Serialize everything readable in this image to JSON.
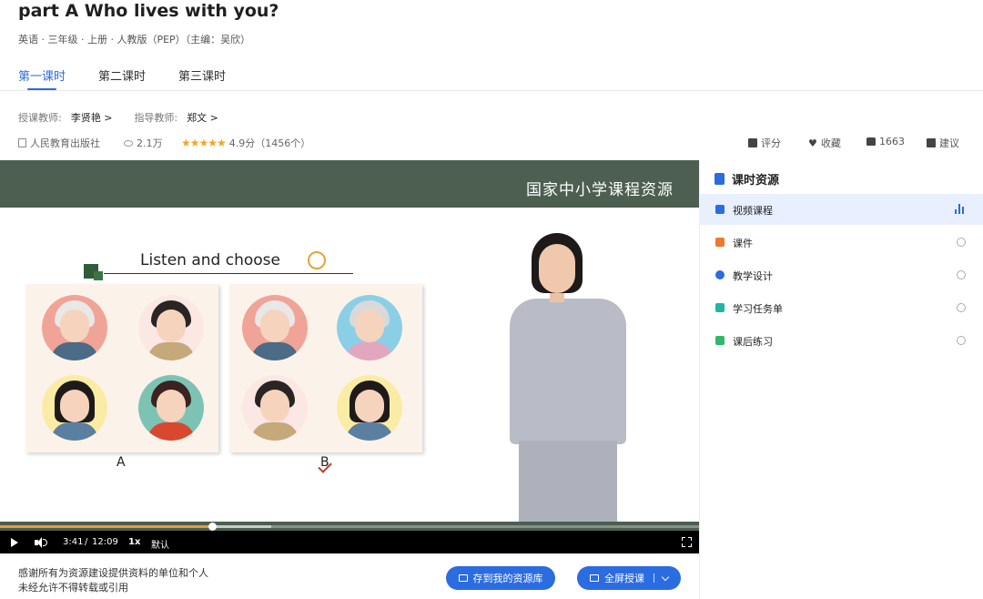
{
  "header": {
    "title": "part A Who lives with you?",
    "meta": "英语 · 三年级 · 上册 · 人教版（PEP）（主编：吴欣）"
  },
  "tabs": [
    {
      "label": "第一课时",
      "active": true
    },
    {
      "label": "第二课时",
      "active": false
    },
    {
      "label": "第三课时",
      "active": false
    }
  ],
  "teachers": {
    "lecturer_label": "授课教师:",
    "lecturer_name": "李贤艳",
    "advisor_label": "指导教师:",
    "advisor_name": "郑文",
    "chevron": ">"
  },
  "info": {
    "publisher": "人民教育出版社",
    "views": "2.1万",
    "stars": "★★★★★",
    "rating": "4.9分（1456个）",
    "actions": {
      "rate": "评分",
      "favorite": "收藏",
      "likes": "1663",
      "suggest": "建议"
    }
  },
  "video": {
    "banner": "国家中小学课程资源",
    "slide_title": "Listen and choose",
    "option_a": "A",
    "option_b": "B",
    "current_time": "3:41",
    "separator": "/",
    "duration": "12:09",
    "speed": "1x",
    "quality": "默认",
    "progress": 0.303,
    "buffered": 0.388
  },
  "footer": {
    "line1": "感谢所有为资源建设提供资料的单位和个人",
    "line2": "未经允许不得转载或引用",
    "save_label": "存到我的资源库",
    "fullscreen_label": "全屏授课"
  },
  "sidebar": {
    "title": "课时资源",
    "items": [
      {
        "label": "视频课程",
        "active": true,
        "icon": "play-icon",
        "color": "#2b6ce0"
      },
      {
        "label": "课件",
        "active": false,
        "icon": "slides-icon",
        "color": "#f0772f"
      },
      {
        "label": "教学设计",
        "active": false,
        "icon": "tools-icon",
        "color": "#2b6ce0"
      },
      {
        "label": "学习任务单",
        "active": false,
        "icon": "clipboard-icon",
        "color": "#21b5a8"
      },
      {
        "label": "课后练习",
        "active": false,
        "icon": "exercise-icon",
        "color": "#2fb86a"
      }
    ]
  },
  "colors": {
    "accent": "#2b6ce0",
    "banner": "#4c5f50",
    "progress": "#e89a3d",
    "stars": "#f4a623"
  }
}
